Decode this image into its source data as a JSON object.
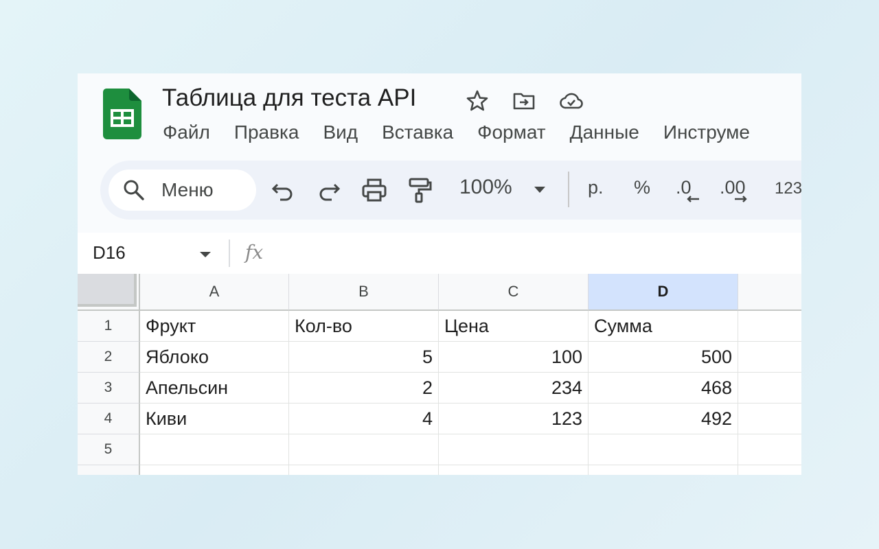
{
  "app": {
    "title": "Таблица для теста API",
    "icons": [
      "star-icon",
      "move-to-folder-icon",
      "cloud-saved-icon"
    ],
    "brand_color": "#188038"
  },
  "menu": [
    "Файл",
    "Правка",
    "Вид",
    "Вставка",
    "Формат",
    "Данные",
    "Инструме"
  ],
  "toolbar": {
    "search_label": "Меню",
    "zoom": "100%",
    "currency": "р.",
    "percent": "%",
    "dec_decrease": ".0",
    "dec_increase": ".00",
    "more_formats": "123",
    "icons": [
      "undo-icon",
      "redo-icon",
      "print-icon",
      "paint-format-icon"
    ]
  },
  "formula_bar": {
    "name_box": "D16",
    "fx_label": "fx",
    "formula": ""
  },
  "sheet": {
    "columns": [
      "A",
      "B",
      "C",
      "D"
    ],
    "selected_column": "D",
    "row_numbers": [
      "1",
      "2",
      "3",
      "4",
      "5"
    ],
    "rows": [
      [
        "Фрукт",
        "Кол-во",
        "Цена",
        "Сумма"
      ],
      [
        "Яблоко",
        "5",
        "100",
        "500"
      ],
      [
        "Апельсин",
        "2",
        "234",
        "468"
      ],
      [
        "Киви",
        "4",
        "123",
        "492"
      ],
      [
        "",
        "",
        "",
        ""
      ]
    ]
  }
}
